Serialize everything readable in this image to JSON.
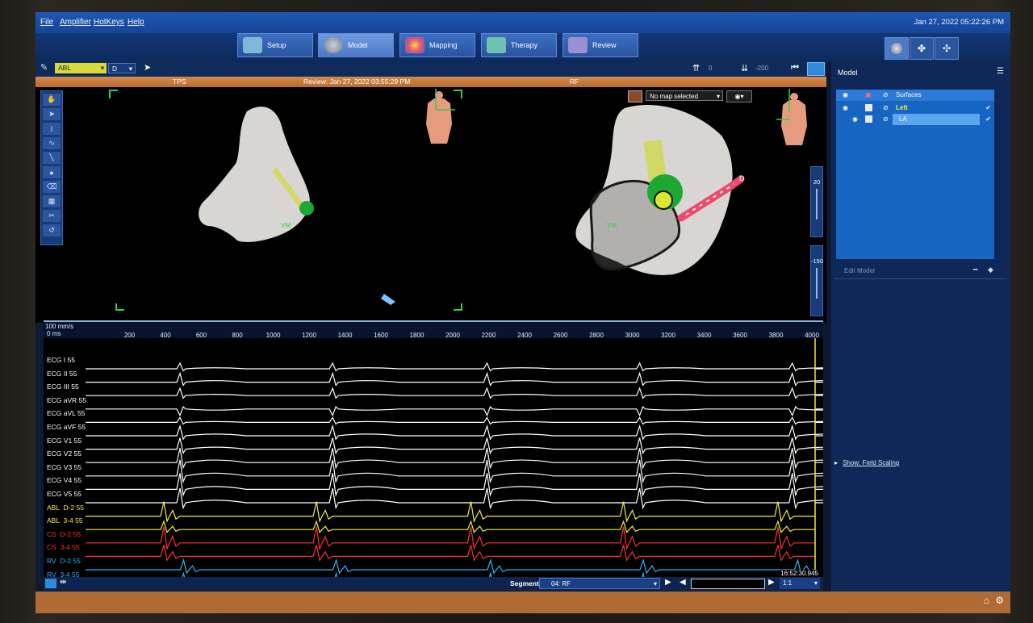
{
  "menu": {
    "file": "File",
    "amplifier": "Amplifier",
    "hotkeys": "HotKeys",
    "help": "Help",
    "datetime": "Jan 27, 2022 05:22:26 PM"
  },
  "workflow_tabs": [
    {
      "label": "Setup",
      "color": "#7fb8d8",
      "active": false
    },
    {
      "label": "Model",
      "color": "#9aa6b5",
      "active": true
    },
    {
      "label": "Mapping",
      "color": "#e05a6a",
      "active": false
    },
    {
      "label": "Therapy",
      "color": "#6fc2b0",
      "active": false
    },
    {
      "label": "Review",
      "color": "#9a8fd0",
      "active": false
    }
  ],
  "toolbar": {
    "catheter": "ABL",
    "electrode": "D",
    "value1": "0",
    "value2": "-200"
  },
  "view_header": {
    "left": "TPS",
    "center": "Review: Jan 27, 2022 03:55:29 PM",
    "right": "RF"
  },
  "viewport": {
    "map_select": "No map selected",
    "label_left": "VM",
    "label_right": "VM",
    "tip_label": "D",
    "zoom_value": "20",
    "rotate_value": "-150"
  },
  "ruler": {
    "speed": "100 mm/s",
    "unit": "0 ms",
    "ticks": [
      "200",
      "400",
      "600",
      "800",
      "1000",
      "1200",
      "1400",
      "1600",
      "1800",
      "2000",
      "2200",
      "2400",
      "2600",
      "2800",
      "3000",
      "3200",
      "3400",
      "3600",
      "3800",
      "4000"
    ]
  },
  "channels": [
    {
      "label": "ECG I 55",
      "color": "#ffffff",
      "kind": "ecg",
      "amp": 7,
      "inv": false
    },
    {
      "label": "ECG II 55",
      "color": "#ffffff",
      "kind": "ecg",
      "amp": 11,
      "inv": false
    },
    {
      "label": "ECG III 55",
      "color": "#ffffff",
      "kind": "ecg",
      "amp": 9,
      "inv": false
    },
    {
      "label": "ECG aVR 55",
      "color": "#ffffff",
      "kind": "ecg",
      "amp": 8,
      "inv": true
    },
    {
      "label": "ECG aVL 55",
      "color": "#ffffff",
      "kind": "ecg",
      "amp": 6,
      "inv": false
    },
    {
      "label": "ECG aVF 55",
      "color": "#ffffff",
      "kind": "ecg",
      "amp": 12,
      "inv": false
    },
    {
      "label": "ECG V1 55",
      "color": "#ffffff",
      "kind": "ecg",
      "amp": 14,
      "inv": false
    },
    {
      "label": "ECG V2 55",
      "color": "#ffffff",
      "kind": "ecg",
      "amp": 18,
      "inv": false
    },
    {
      "label": "ECG V3 55",
      "color": "#ffffff",
      "kind": "ecg",
      "amp": 20,
      "inv": false
    },
    {
      "label": "ECG V4 55",
      "color": "#ffffff",
      "kind": "ecg",
      "amp": 20,
      "inv": false
    },
    {
      "label": "ECG V5 55",
      "color": "#ffffff",
      "kind": "ecg",
      "amp": 18,
      "inv": false
    },
    {
      "label": "ABL  D-2 55",
      "color": "#f0f040",
      "kind": "egm",
      "amp": 18,
      "inv": false
    },
    {
      "label": "ABL  3-4 55",
      "color": "#f0f040",
      "kind": "egm",
      "amp": 10,
      "inv": false
    },
    {
      "label": "CS  D-2 55",
      "color": "#ff3030",
      "kind": "egm",
      "amp": 20,
      "inv": false
    },
    {
      "label": "CS  3-4 55",
      "color": "#ff3030",
      "kind": "egm",
      "amp": 14,
      "inv": false
    },
    {
      "label": "RV  D-2 55",
      "color": "#29b6f6",
      "kind": "egm",
      "amp": 12,
      "inv": false
    },
    {
      "label": "RV  3-4 55",
      "color": "#29b6f6",
      "kind": "egm",
      "amp": 12,
      "inv": false
    }
  ],
  "beats": [
    {
      "ecg_ms": 490,
      "abl_ms": 400
    },
    {
      "ecg_ms": 1340,
      "abl_ms": 1250
    },
    {
      "ecg_ms": 2200,
      "abl_ms": 2110
    },
    {
      "ecg_ms": 3050,
      "abl_ms": 2960
    },
    {
      "ecg_ms": 3900,
      "abl_ms": 3820
    }
  ],
  "timestamp": "16:52:30.945",
  "segment": {
    "label": "Segment",
    "value": "04: RF",
    "ratio": "1:1"
  },
  "sidebar": {
    "title": "Model",
    "col_surfaces": "Surfaces",
    "item_left": "Left",
    "item_la": "LA",
    "edit_model": "Edit Model",
    "show_field_scaling": "Show: Field Scaling"
  }
}
